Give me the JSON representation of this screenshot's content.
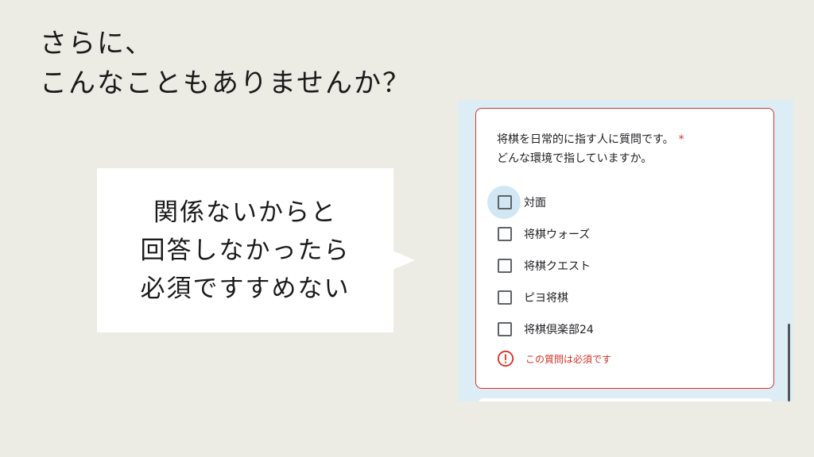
{
  "slide": {
    "title_line1": "さらに、",
    "title_line2": "こんなこともありませんか？"
  },
  "callout": {
    "line1": "関係ないからと",
    "line2": "回答しなかったら",
    "line3": "必須ですすめない"
  },
  "form": {
    "question_line1": "将棋を日常的に指す人に質問です。",
    "required_mark": "*",
    "question_line2": "どんな環境で指していますか。",
    "options": [
      {
        "label": "対面",
        "checked": false,
        "focused": true
      },
      {
        "label": "将棋ウォーズ",
        "checked": false,
        "focused": false
      },
      {
        "label": "将棋クエスト",
        "checked": false,
        "focused": false
      },
      {
        "label": "ピヨ将棋",
        "checked": false,
        "focused": false
      },
      {
        "label": "将棋倶楽部24",
        "checked": false,
        "focused": false
      }
    ],
    "error_icon": "exclamation-circle-icon",
    "error_message": "この質問は必須です"
  },
  "colors": {
    "background": "#ecebe4",
    "form_panel": "#dcedf6",
    "error": "#d93025",
    "focus_ring": "#d2e7f4"
  }
}
